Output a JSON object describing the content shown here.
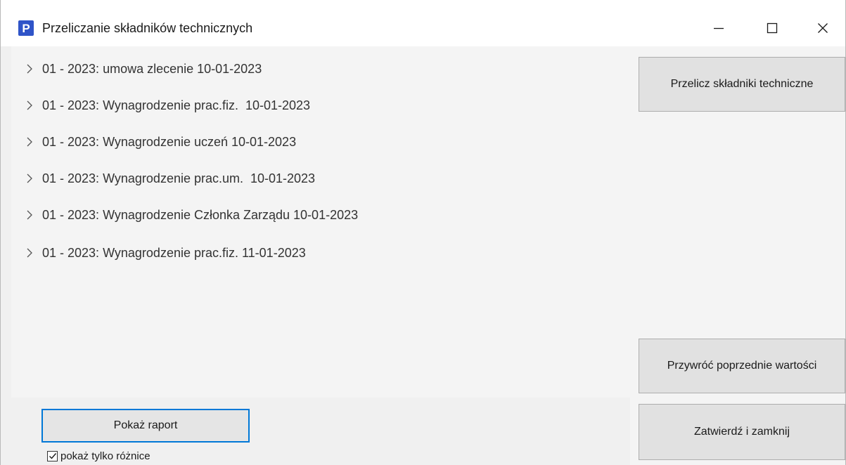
{
  "window": {
    "title": "Przeliczanie składników technicznych",
    "app_icon_letter": "P",
    "accent_color": "#2f54c8"
  },
  "tree": {
    "items": [
      {
        "label": "01 - 2023: umowa zlecenie 10-01-2023"
      },
      {
        "label": "01 - 2023: Wynagrodzenie prac.fiz.  10-01-2023"
      },
      {
        "label": "01 - 2023: Wynagrodzenie uczeń 10-01-2023"
      },
      {
        "label": "01 - 2023: Wynagrodzenie prac.um.  10-01-2023"
      },
      {
        "label": "01 - 2023: Wynagrodzenie Członka Zarządu 10-01-2023"
      },
      {
        "label": "01 - 2023: Wynagrodzenie prac.fiz. 11-01-2023"
      }
    ]
  },
  "buttons": {
    "recalc": "Przelicz składniki techniczne",
    "restore": "Przywróć poprzednie wartości",
    "confirm": "Zatwierdź i zamknij",
    "report": "Pokaż raport"
  },
  "options": {
    "only_differences_label": "pokaż tylko różnice",
    "only_differences_checked": true
  }
}
